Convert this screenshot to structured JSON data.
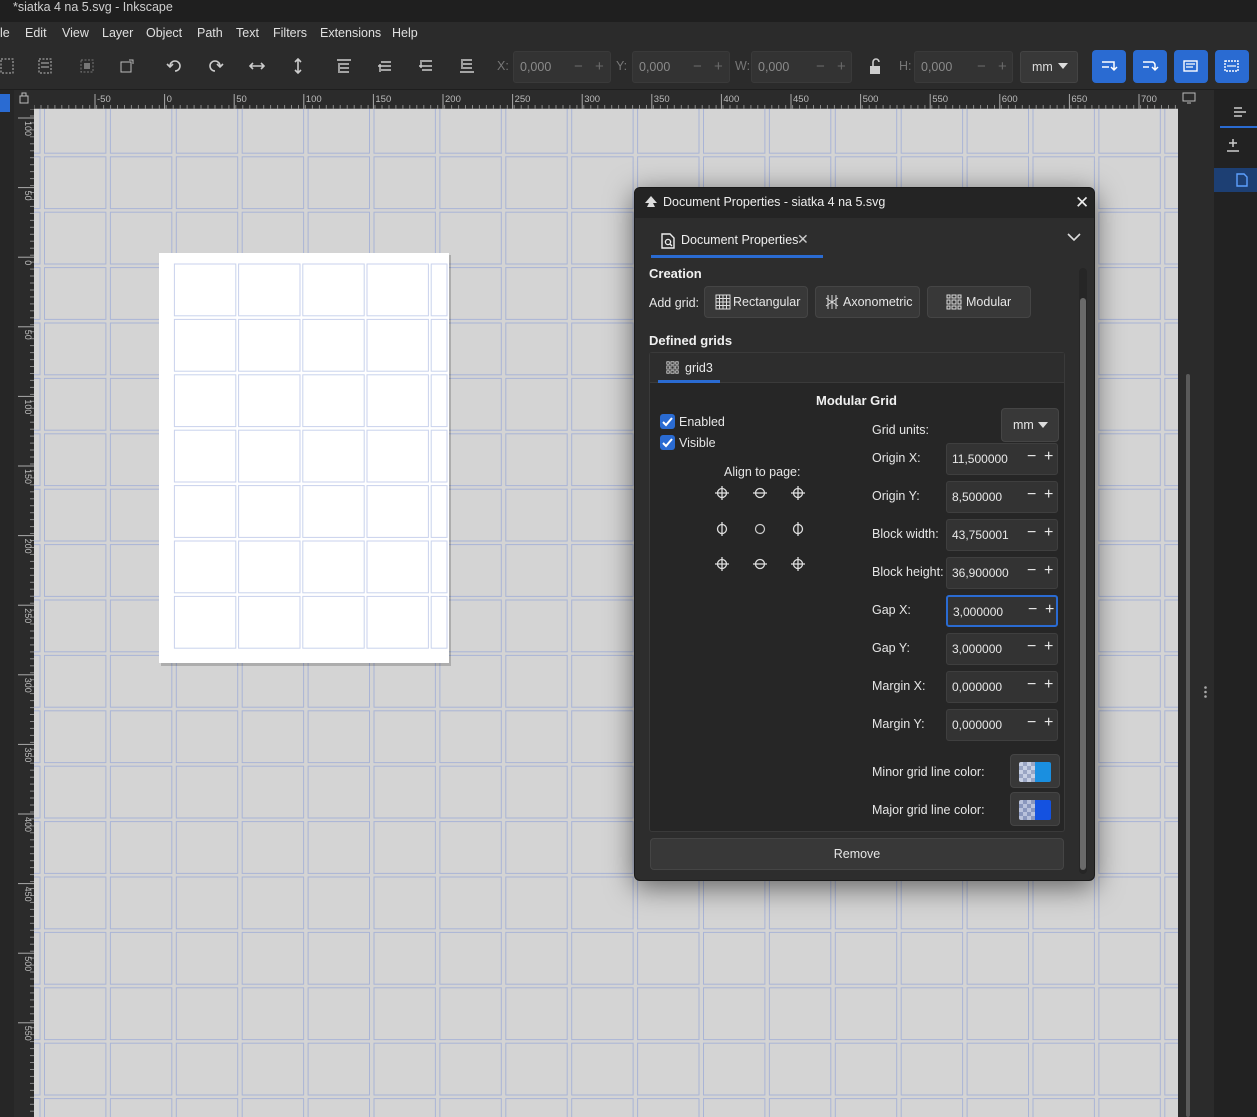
{
  "window": {
    "title": "*siatka  4 na 5.svg - Inkscape"
  },
  "menu": [
    "le",
    "Edit",
    "View",
    "Layer",
    "Object",
    "Path",
    "Text",
    "Filters",
    "Extensions",
    "Help"
  ],
  "toolbar": {
    "x_label": "X:",
    "x_value": "0,000",
    "y_label": "Y:",
    "y_value": "0,000",
    "w_label": "W:",
    "w_value": "0,000",
    "h_label": "H:",
    "h_value": "0,000",
    "units": "mm",
    "minus": "−",
    "plus": "+"
  },
  "ruler": {
    "top_labels": [
      "-50",
      "0",
      "50",
      "100",
      "150",
      "200",
      "250",
      "300",
      "350",
      "400",
      "450",
      "500",
      "550",
      "600",
      "650",
      "700"
    ],
    "left_labels": [
      "100",
      "50",
      "0",
      "50",
      "100",
      "150",
      "200",
      "250",
      "300",
      "350",
      "400",
      "450",
      "500",
      "550"
    ]
  },
  "dialog": {
    "title": "Document Properties - siatka  4 na 5.svg",
    "tab_label": "Document Properties",
    "creation_heading": "Creation",
    "add_grid_label": "Add grid:",
    "add_buttons": [
      "Rectangular",
      "Axonometric",
      "Modular"
    ],
    "defined_grids_heading": "Defined grids",
    "grid_tab": "grid3",
    "grid_title": "Modular Grid",
    "enabled_label": "Enabled",
    "visible_label": "Visible",
    "enabled": true,
    "visible": true,
    "align_label": "Align to page:",
    "grid_units_label": "Grid units:",
    "grid_units_value": "mm",
    "fields": [
      {
        "label": "Origin X:",
        "value": "11,500000"
      },
      {
        "label": "Origin Y:",
        "value": "8,500000"
      },
      {
        "label": "Block width:",
        "value": "43,750001"
      },
      {
        "label": "Block height:",
        "value": "36,900000"
      },
      {
        "label": "Gap X:",
        "value": "3,000000"
      },
      {
        "label": "Gap Y:",
        "value": "3,000000"
      },
      {
        "label": "Margin X:",
        "value": "0,000000"
      },
      {
        "label": "Margin Y:",
        "value": "0,000000"
      }
    ],
    "minor_color_label": "Minor grid line color:",
    "major_color_label": "Major grid line color:",
    "minor_color": "#1a8fe0",
    "major_color": "#1452e0",
    "remove_label": "Remove"
  },
  "colors": {
    "accent": "#2a6bd2",
    "grid_line": "#a9b4d6",
    "canvas": "#d4d4d4",
    "page": "#ffffff"
  }
}
